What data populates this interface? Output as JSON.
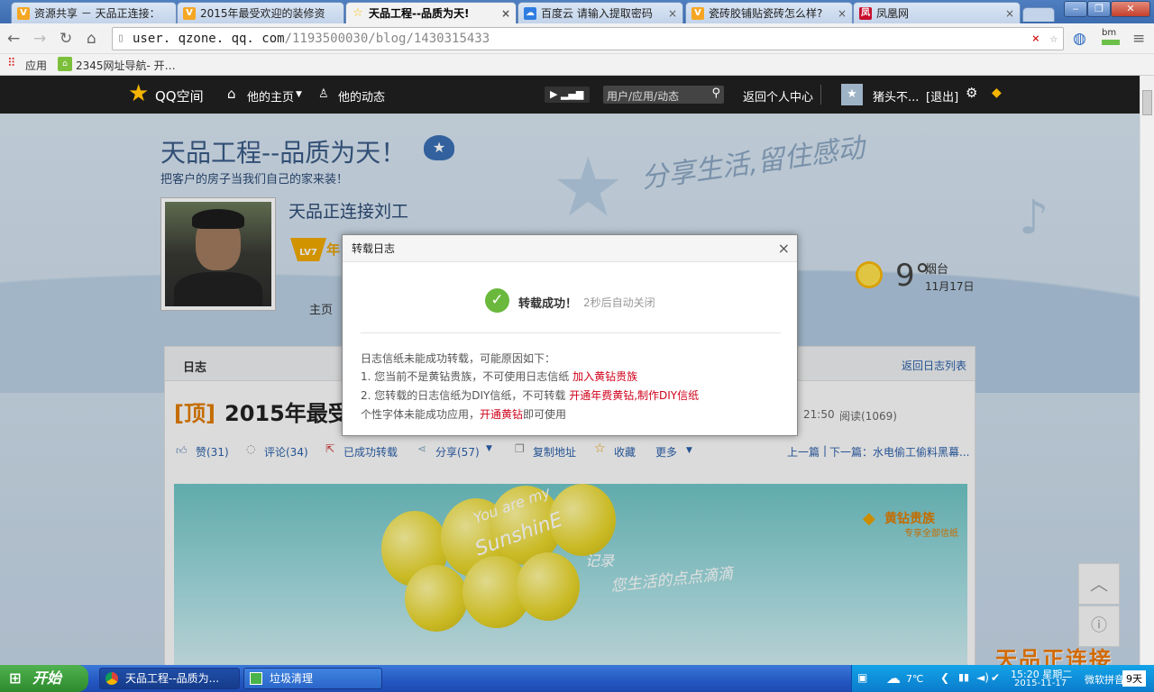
{
  "browser": {
    "tabs": [
      {
        "label": "资源共享 － 天品正连接：",
        "icon": "v-icon",
        "color": "#f5a623"
      },
      {
        "label": "2015年最受欢迎的装修资",
        "icon": "v-icon",
        "color": "#f5a623"
      },
      {
        "label": "天品工程--品质为天!",
        "icon": "star-icon",
        "color": "#f5c518",
        "active": true
      },
      {
        "label": "百度云 请输入提取密码",
        "icon": "baidu-cloud-icon",
        "color": "#2f7de1"
      },
      {
        "label": "瓷砖胶铺贴瓷砖怎么样?",
        "icon": "v-icon",
        "color": "#f5a623"
      },
      {
        "label": "凤凰网",
        "icon": "ifeng-icon",
        "color": "#c8102e"
      }
    ],
    "tab_close": "×",
    "window_buttons": [
      "‒",
      "❐",
      "✕"
    ],
    "url_host": "user. qzone. qq. com",
    "url_path": "/1193500030/blog/1430315433",
    "profile_label": "bm",
    "bookmarks": [
      {
        "label": "应用",
        "icon": "apps-grid-icon"
      },
      {
        "label": "2345网址导航- 开…",
        "icon": "2345-icon"
      }
    ]
  },
  "qzone_nav": {
    "logo": "QQ空间",
    "home": "他的主页",
    "feeds": "他的动态",
    "search_placeholder": "用户/应用/动态",
    "back": "返回个人中心",
    "username": "猪头不...",
    "logout": "[退出]"
  },
  "blog": {
    "title": "天品工程--品质为天！",
    "subtitle": "把客户的房子当我们自己的家来装！",
    "slogan": "分享生活,留住感动",
    "owner_name": "天品正连接刘工",
    "level": "LV7",
    "year_badge": "年",
    "tab_home": "主页",
    "weather_temp": "9°",
    "weather_city": "烟台",
    "weather_date": "11月17日",
    "section_label": "日志",
    "back_to_list": "返回日志列表",
    "post_tag": "[顶]",
    "post_title": "2015年最受",
    "post_time": "21:50",
    "post_reads": "阅读(1069)",
    "actions": {
      "like": "赞(31)",
      "comment": "评论(34)",
      "repost": "已成功转载",
      "share": "分享(57)",
      "copy": "复制地址",
      "favorite": "收藏",
      "more": "更多"
    },
    "prev": "上一篇",
    "next": "下一篇：水电偷工偷料黑幕...",
    "banner_text1": "You are my",
    "banner_text2": "SunshinE",
    "banner_text3": "记录",
    "banner_text4": "您生活的点点滴滴",
    "vip_label": "黄钻贵族",
    "vip_sub": "专享全部信纸",
    "watermark": "天品正连接"
  },
  "dialog": {
    "title": "转载日志",
    "close": "×",
    "success": "转载成功！",
    "auto_close": "2秒后自动关闭",
    "reason_head": "日志信纸未能成功转载，可能原因如下：",
    "r1_text": "1. 您当前不是黄钻贵族，不可使用日志信纸",
    "r1_link": "加入黄钻贵族",
    "r2_text": "2. 您转载的日志信纸为DIY信纸，不可转载",
    "r2_link": "开通年费黄钻,制作DIY信纸",
    "r3_text": "个性字体未能成功应用，",
    "r3_link": "开通黄钻",
    "r3_tail": "即可使用"
  },
  "taskbar": {
    "start": "开始",
    "items": [
      "天品工程--品质为...",
      "垃圾清理"
    ],
    "weather": "7℃",
    "time": "15:20 星期二",
    "date": "2015-11-17",
    "ime": "微软拼音",
    "days": "9天"
  }
}
